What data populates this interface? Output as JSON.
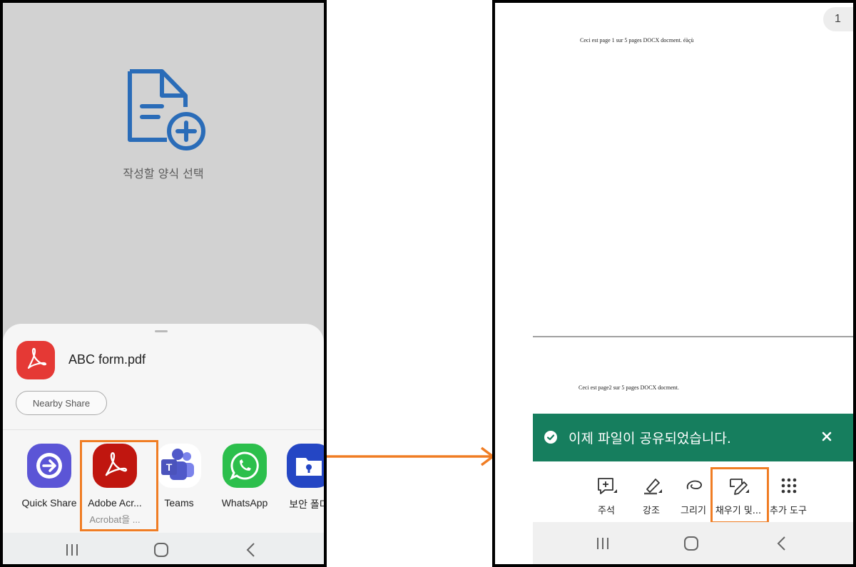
{
  "left_phone": {
    "form_caption": "작성할 양식 선택",
    "share_sheet": {
      "file_name": "ABC form.pdf",
      "nearby_share_label": "Nearby Share",
      "apps": [
        {
          "label": "Quick Share",
          "sub": "",
          "icon": "quick-share-icon",
          "color": "#5b55d6"
        },
        {
          "label": "Adobe Acr...",
          "sub": "Acrobat을 ...",
          "icon": "adobe-acrobat-icon",
          "color": "#c0160f"
        },
        {
          "label": "Teams",
          "sub": "",
          "icon": "teams-icon",
          "color": "#5059c9"
        },
        {
          "label": "WhatsApp",
          "sub": "",
          "icon": "whatsapp-icon",
          "color": "#2cbf4c"
        },
        {
          "label": "보안 폴더",
          "sub": "",
          "icon": "secure-folder-icon",
          "color": "#2446c4"
        }
      ]
    },
    "nav": [
      "recent-apps-icon",
      "home-icon",
      "back-icon"
    ]
  },
  "right_phone": {
    "page_number": "1",
    "doc_page1_text": "Ceci est page 1 sur 5 pages DOCX docment. éàçù",
    "doc_page2_text": "Ceci est page2 sur 5 pages DOCX docment.",
    "toast": {
      "text": "이제 파일이 공유되었습니다.",
      "color": "#167e5e"
    },
    "tools": [
      {
        "label": "주석",
        "icon": "comment-icon"
      },
      {
        "label": "강조",
        "icon": "highlighter-icon"
      },
      {
        "label": "그리기",
        "icon": "draw-icon"
      },
      {
        "label": "채우기 및...",
        "icon": "fill-sign-icon"
      },
      {
        "label": "추가 도구",
        "icon": "more-tools-icon"
      }
    ]
  },
  "colors": {
    "highlight": "#f07d24",
    "accent_blue": "#2a6cb8"
  }
}
